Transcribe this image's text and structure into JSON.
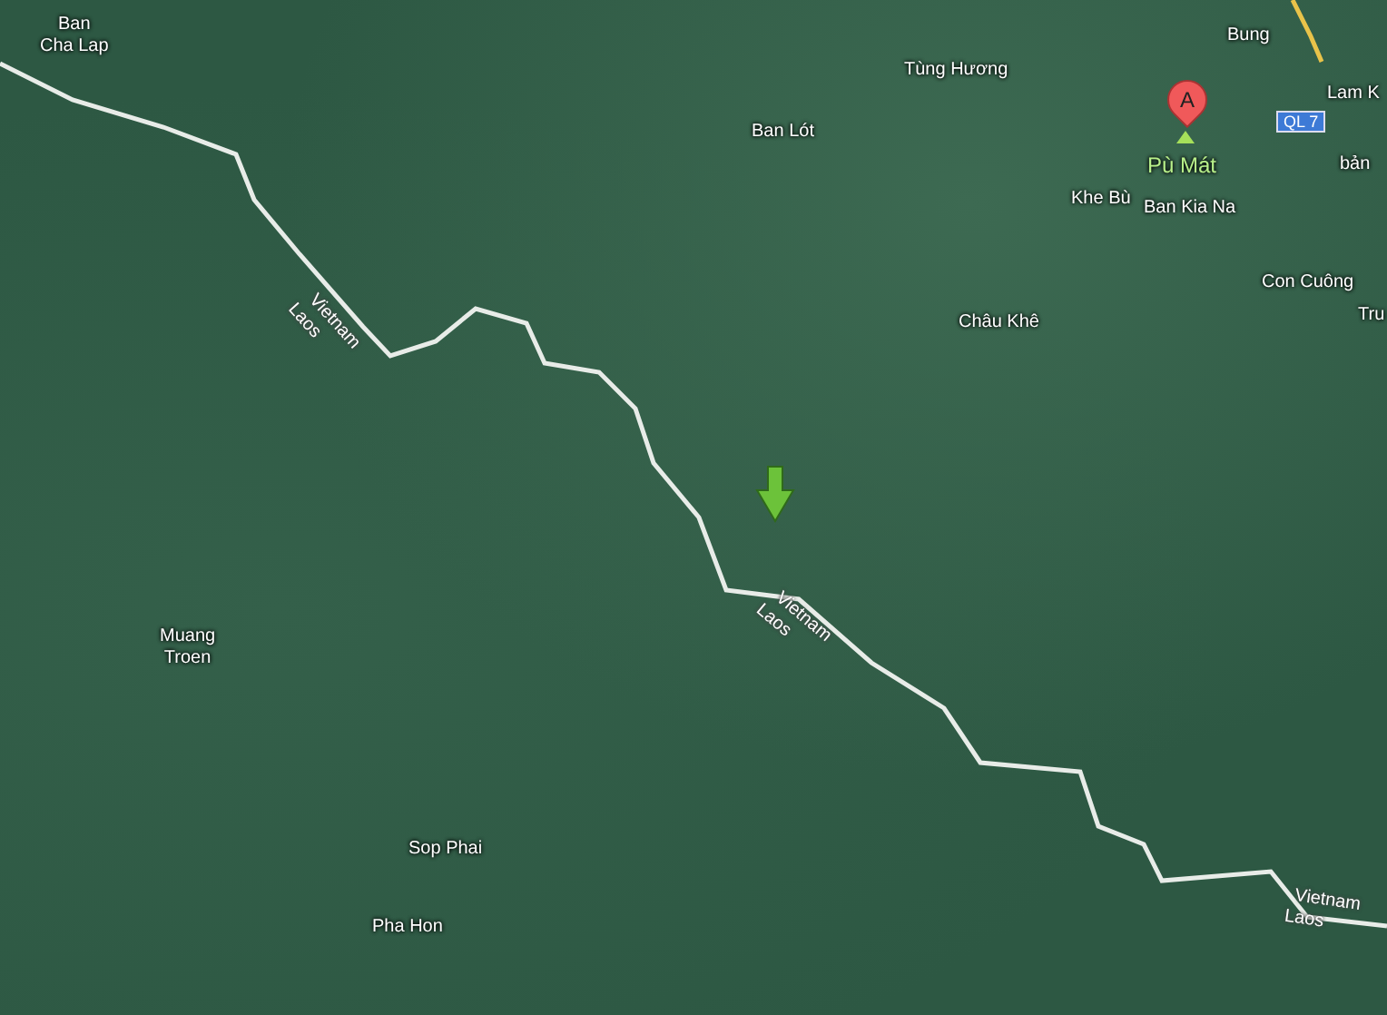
{
  "place_labels": [
    {
      "text": "Ban\nCha Lap"
    },
    {
      "text": "Tùng Hương"
    },
    {
      "text": "Ban Lót"
    },
    {
      "text": "Bung"
    },
    {
      "text": "Lam K"
    },
    {
      "text": "Khe Bù"
    },
    {
      "text": "Ban Kia Na"
    },
    {
      "text": "bản"
    },
    {
      "text": "Con Cuông"
    },
    {
      "text": "Tru"
    },
    {
      "text": "Châu Khê"
    },
    {
      "text": "Muang\nTroen"
    },
    {
      "text": "Sop Phai"
    },
    {
      "text": "Pha Hon"
    }
  ],
  "border_labels": [
    {
      "upper": "Vietnam",
      "lower": "Laos"
    },
    {
      "upper": "Vietnam",
      "lower": "Laos"
    },
    {
      "upper": "Vietnam",
      "lower": "Laos"
    }
  ],
  "road_shield": {
    "text": "QL 7"
  },
  "marker": {
    "letter": "A",
    "label": "Pù Mát"
  }
}
